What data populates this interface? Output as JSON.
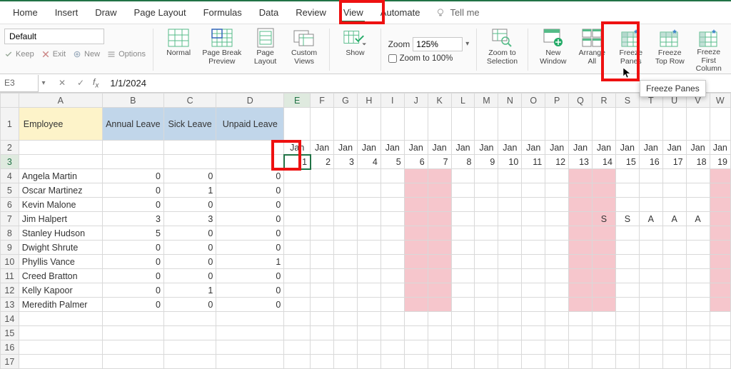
{
  "menu": {
    "items": [
      "Home",
      "Insert",
      "Draw",
      "Page Layout",
      "Formulas",
      "Data",
      "Review",
      "View",
      "Automate"
    ],
    "active": "View",
    "tellme": "Tell me"
  },
  "ribbon": {
    "font_name": "Default",
    "tiny": {
      "keep": "Keep",
      "exit": "Exit",
      "new": "New",
      "options": "Options"
    },
    "normal": "Normal",
    "page_break": "Page Break Preview",
    "page_layout": "Page Layout",
    "custom_views": "Custom Views",
    "show": "Show",
    "zoom_label": "Zoom",
    "zoom_value": "125%",
    "zoom_100": "Zoom to 100%",
    "zoom_sel": "Zoom to Selection",
    "new_window": "New Window",
    "arrange_all": "Arrange All",
    "freeze_panes": "Freeze Panes",
    "freeze_top": "Freeze Top Row",
    "freeze_first": "Freeze First Column",
    "tooltip": "Freeze Panes"
  },
  "namebox": {
    "ref": "E3",
    "formula": "1/1/2024"
  },
  "columns": [
    {
      "letter": "A",
      "w": 118
    },
    {
      "letter": "B",
      "w": 87
    },
    {
      "letter": "C",
      "w": 74
    },
    {
      "letter": "D",
      "w": 96
    },
    {
      "letter": "E",
      "w": 37
    },
    {
      "letter": "F",
      "w": 33
    },
    {
      "letter": "G",
      "w": 33
    },
    {
      "letter": "H",
      "w": 33
    },
    {
      "letter": "I",
      "w": 33
    },
    {
      "letter": "J",
      "w": 33
    },
    {
      "letter": "K",
      "w": 33
    },
    {
      "letter": "L",
      "w": 33
    },
    {
      "letter": "M",
      "w": 33
    },
    {
      "letter": "N",
      "w": 33
    },
    {
      "letter": "O",
      "w": 33
    },
    {
      "letter": "P",
      "w": 33
    },
    {
      "letter": "Q",
      "w": 33
    },
    {
      "letter": "R",
      "w": 33
    },
    {
      "letter": "S",
      "w": 33
    },
    {
      "letter": "T",
      "w": 33
    },
    {
      "letter": "U",
      "w": 33
    },
    {
      "letter": "V",
      "w": 33
    },
    {
      "letter": "W",
      "w": 26
    }
  ],
  "headers": {
    "employee": "Employee",
    "annual": "Annual Leave",
    "sick": "Sick Leave",
    "unpaid": "Unpaid Leave"
  },
  "month_label": "Jan",
  "days": [
    1,
    2,
    3,
    4,
    5,
    6,
    7,
    8,
    9,
    10,
    11,
    12,
    13,
    14,
    15,
    16,
    17,
    18,
    19
  ],
  "weekend_days": [
    6,
    7,
    13,
    14
  ],
  "last_weekend_col": "W",
  "employees": [
    {
      "name": "Angela Martin",
      "a": 0,
      "s": 0,
      "u": 0,
      "marks": {}
    },
    {
      "name": "Oscar Martinez",
      "a": 0,
      "s": 1,
      "u": 0,
      "marks": {}
    },
    {
      "name": "Kevin Malone",
      "a": 0,
      "s": 0,
      "u": 0,
      "marks": {}
    },
    {
      "name": "Jim Halpert",
      "a": 3,
      "s": 3,
      "u": 0,
      "marks": {
        "14": "S",
        "15": "S",
        "16": "A",
        "17": "A",
        "18": "A"
      }
    },
    {
      "name": "Stanley Hudson",
      "a": 5,
      "s": 0,
      "u": 0,
      "marks": {}
    },
    {
      "name": "Dwight Shrute",
      "a": 0,
      "s": 0,
      "u": 0,
      "marks": {}
    },
    {
      "name": "Phyllis Vance",
      "a": 0,
      "s": 0,
      "u": 1,
      "marks": {}
    },
    {
      "name": "Creed Bratton",
      "a": 0,
      "s": 0,
      "u": 0,
      "marks": {}
    },
    {
      "name": "Kelly Kapoor",
      "a": 0,
      "s": 1,
      "u": 0,
      "marks": {}
    },
    {
      "name": "Meredith Palmer",
      "a": 0,
      "s": 0,
      "u": 0,
      "marks": {}
    }
  ],
  "empty_rows": [
    14,
    15,
    16,
    17
  ],
  "colors": {
    "accent": "#217346",
    "highlight": "#e11"
  }
}
